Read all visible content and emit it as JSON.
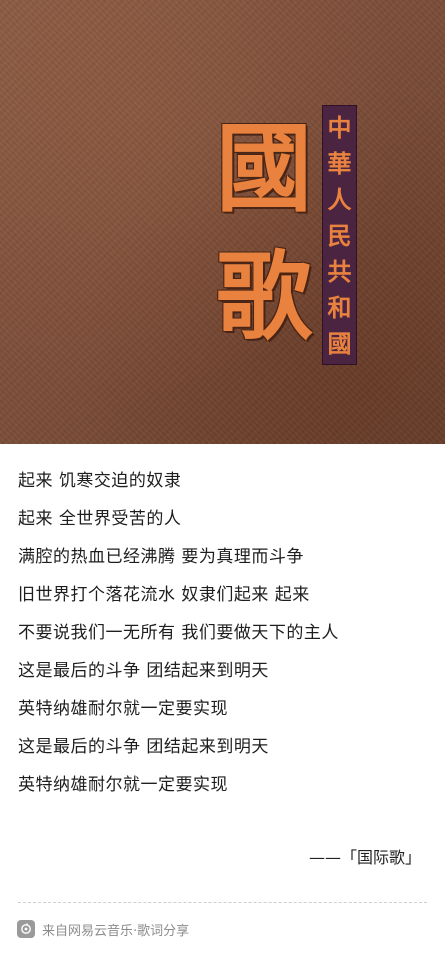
{
  "cover": {
    "big_chars": [
      "國",
      "歌"
    ],
    "vertical_text": [
      "中",
      "華",
      "人",
      "民",
      "共",
      "和",
      "國"
    ],
    "colors": {
      "background": "#7d4f3a",
      "title": "#e8823e",
      "banner": "#4a2440"
    }
  },
  "lyrics": [
    "起来 饥寒交迫的奴隶",
    "起来 全世界受苦的人",
    "满腔的热血已经沸腾 要为真理而斗争",
    "旧世界打个落花流水 奴隶们起来 起来",
    "不要说我们一无所有 我们要做天下的主人",
    "这是最后的斗争 团结起来到明天",
    "英特纳雄耐尔就一定要实现",
    "这是最后的斗争 团结起来到明天",
    "英特纳雄耐尔就一定要实现"
  ],
  "attribution": "——「国际歌」",
  "footer": {
    "icon": "netease-music-icon",
    "text": "来自网易云音乐·歌词分享"
  }
}
